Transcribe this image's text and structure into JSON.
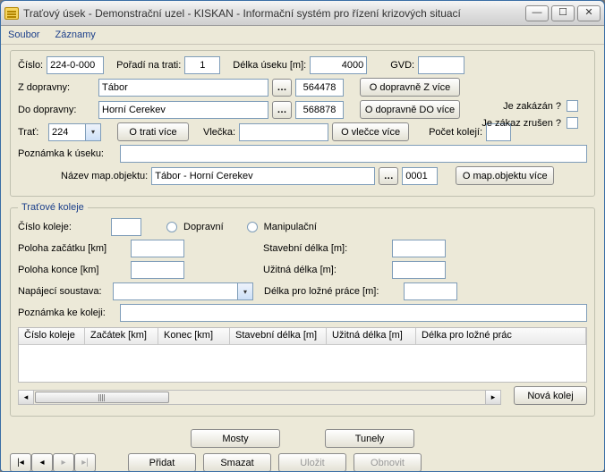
{
  "window": {
    "title": "Traťový úsek - Demonstrační uzel - KISKAN - Informační systém pro řízení krizových situací"
  },
  "menu": {
    "file": "Soubor",
    "records": "Záznamy"
  },
  "main": {
    "cislo_lbl": "Číslo:",
    "cislo_val": "224-0-000",
    "poradi_lbl": "Pořadí na trati:",
    "poradi_val": "1",
    "delka_lbl": "Délka úseku [m]:",
    "delka_val": "4000",
    "gvd_lbl": "GVD:",
    "gvd_val": "",
    "zdop_lbl": "Z dopravny:",
    "zdop_val": "Tábor",
    "zdop_code": "564478",
    "zdop_more": "O dopravně Z více",
    "dodop_lbl": "Do dopravny:",
    "dodop_val": "Horní Cerekev",
    "dodop_code": "568878",
    "dodop_more": "O dopravně DO více",
    "trat_lbl": "Trať:",
    "trat_val": "224",
    "trat_more": "O trati více",
    "vlecka_lbl": "Vlečka:",
    "vlecka_val": "",
    "vlecka_more": "O vlečce více",
    "pocet_lbl": "Počet kolejí:",
    "pocet_val": "",
    "pozn_lbl": "Poznámka k úseku:",
    "pozn_val": "",
    "mapobj_lbl": "Název map.objektu:",
    "mapobj_val": "Tábor - Horní Cerekev",
    "mapobj_code": "0001",
    "mapobj_more": "O map.objektu více",
    "zakazan_lbl": "Je zakázán ?",
    "zrusen_lbl": "Je zákaz zrušen ?"
  },
  "koleje": {
    "legend": "Traťové koleje",
    "cislo_lbl": "Číslo koleje:",
    "cislo_val": "",
    "dopravni_opt": "Dopravní",
    "manip_opt": "Manipulační",
    "polzac_lbl": "Poloha začátku [km]",
    "polzac_val": "",
    "polkon_lbl": "Poloha konce [km]",
    "polkon_val": "",
    "stav_lbl": "Stavební délka [m]:",
    "stav_val": "",
    "uzit_lbl": "Užitná délka [m]:",
    "uzit_val": "",
    "napaj_lbl": "Napájecí soustava:",
    "napaj_val": "",
    "lozne_lbl": "Délka pro ložné práce [m]:",
    "lozne_val": "",
    "poznk_lbl": "Poznámka ke koleji:",
    "poznk_val": "",
    "cols": {
      "c1": "Číslo koleje",
      "c2": "Začátek [km]",
      "c3": "Konec [km]",
      "c4": "Stavební délka [m]",
      "c5": "Užitná délka [m]",
      "c6": "Délka pro ložné prác"
    },
    "new_btn": "Nová kolej"
  },
  "mid": {
    "mosty": "Mosty",
    "tunely": "Tunely"
  },
  "footer": {
    "add": "Přidat",
    "del": "Smazat",
    "save": "Uložit",
    "refresh": "Obnovit"
  }
}
